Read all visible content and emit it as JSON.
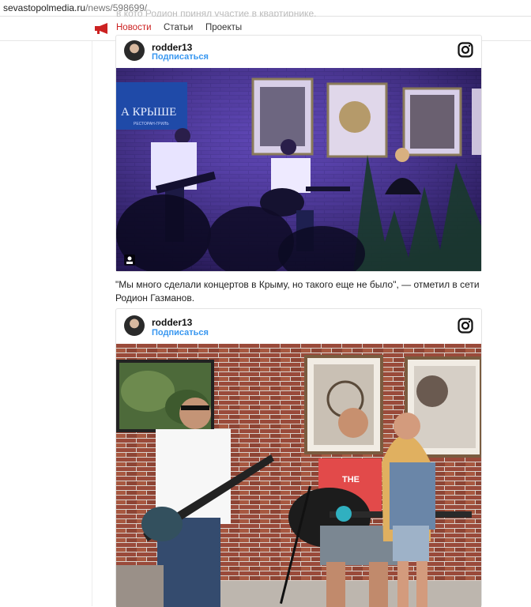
{
  "browser": {
    "domain": "sevastopolmedia.ru",
    "path": "/news/598699/"
  },
  "overlap_text": "в кото Родион принял участие в квартирнике.",
  "nav": {
    "items": [
      {
        "label": "Новости",
        "active": true
      },
      {
        "label": "Статьи"
      },
      {
        "label": "Проекты"
      }
    ]
  },
  "posts": [
    {
      "username": "rodder13",
      "follow_label": "Подписаться",
      "photo": {
        "venue_sign": "А КРЫШЕ",
        "venue_sub": "РЕСТОРАН-ГРИЛЬ"
      }
    },
    {
      "username": "rodder13",
      "follow_label": "Подписаться",
      "photo": {
        "shirt_text": "THE"
      }
    }
  ],
  "quote": "\"Мы много сделали концертов в Крыму, но такого еще не было\", — отметил в сети Родион Газманов.",
  "colors": {
    "accent": "#cc2222",
    "link": "#3897f0"
  }
}
